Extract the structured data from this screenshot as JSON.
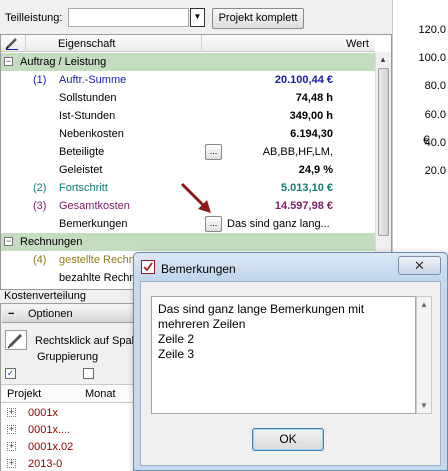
{
  "toolbar": {
    "teilleistung_label": "Teilleistung:",
    "teilleistung_value": "",
    "projekt_komplett_label": "Projekt komplett"
  },
  "grid": {
    "col_eigenschaft": "Eigenschaft",
    "col_wert": "Wert"
  },
  "groups": {
    "auftrag": "Auftrag / Leistung",
    "rechnungen": "Rechnungen"
  },
  "rows": {
    "auftragssumme": {
      "num": "(1)",
      "name": "Auftr.-Summe",
      "value": "20.100,44 €"
    },
    "sollstunden": {
      "name": "Sollstunden",
      "value": "74,48 h"
    },
    "iststunden": {
      "name": "Ist-Stunden",
      "value": "349,00 h"
    },
    "nebenkosten": {
      "name": "Nebenkosten",
      "value": "6.194,30"
    },
    "beteiligte": {
      "name": "Beteiligte",
      "ellipsis": "...",
      "value": "AB,BB,HF,LM,"
    },
    "geleistet": {
      "name": "Geleistet",
      "value": "24,9 %"
    },
    "fortschritt": {
      "num": "(2)",
      "name": "Fortschritt",
      "value": "5.013,10 €"
    },
    "gesamtkosten": {
      "num": "(3)",
      "name": "Gesamtkosten",
      "value": "14.597,98 €"
    },
    "bemerkungen": {
      "name": "Bemerkungen",
      "ellipsis": "...",
      "value": "Das sind ganz lang..."
    },
    "gestellte": {
      "num": "(4)",
      "name": "gestellte Rechn"
    },
    "bezahlte": {
      "name": "bezahlte Rechn"
    }
  },
  "lower": {
    "kostenverteilung": "Kostenverteilung",
    "optionen": "Optionen",
    "rechtsklick": "Rechtsklick auf Spalt",
    "gruppierung": "Gruppierung",
    "col_projekt": "Projekt",
    "col_monat": "Monat",
    "projects": [
      "0001x",
      "0001x....",
      "0001x.02",
      "2013-0"
    ]
  },
  "chart_axis": {
    "ticks": [
      "120.0",
      "100.0",
      "80.0",
      "60.0",
      "40.0",
      "20.0"
    ],
    "unit": "€"
  },
  "dialog": {
    "title": "Bemerkungen",
    "lines": [
      "Das sind ganz lange Bemerkungen mit",
      "mehreren Zeilen",
      "Zeile 2",
      "Zeile 3"
    ],
    "ok_label": "OK",
    "close_symbol": "✕"
  },
  "colors": {
    "group_bg": "#c4dcbf",
    "blue": "#1a1aa8",
    "teal": "#117d77",
    "purple": "#7a2266",
    "olive": "#8c7a16",
    "arrow": "#8b1a1a"
  }
}
